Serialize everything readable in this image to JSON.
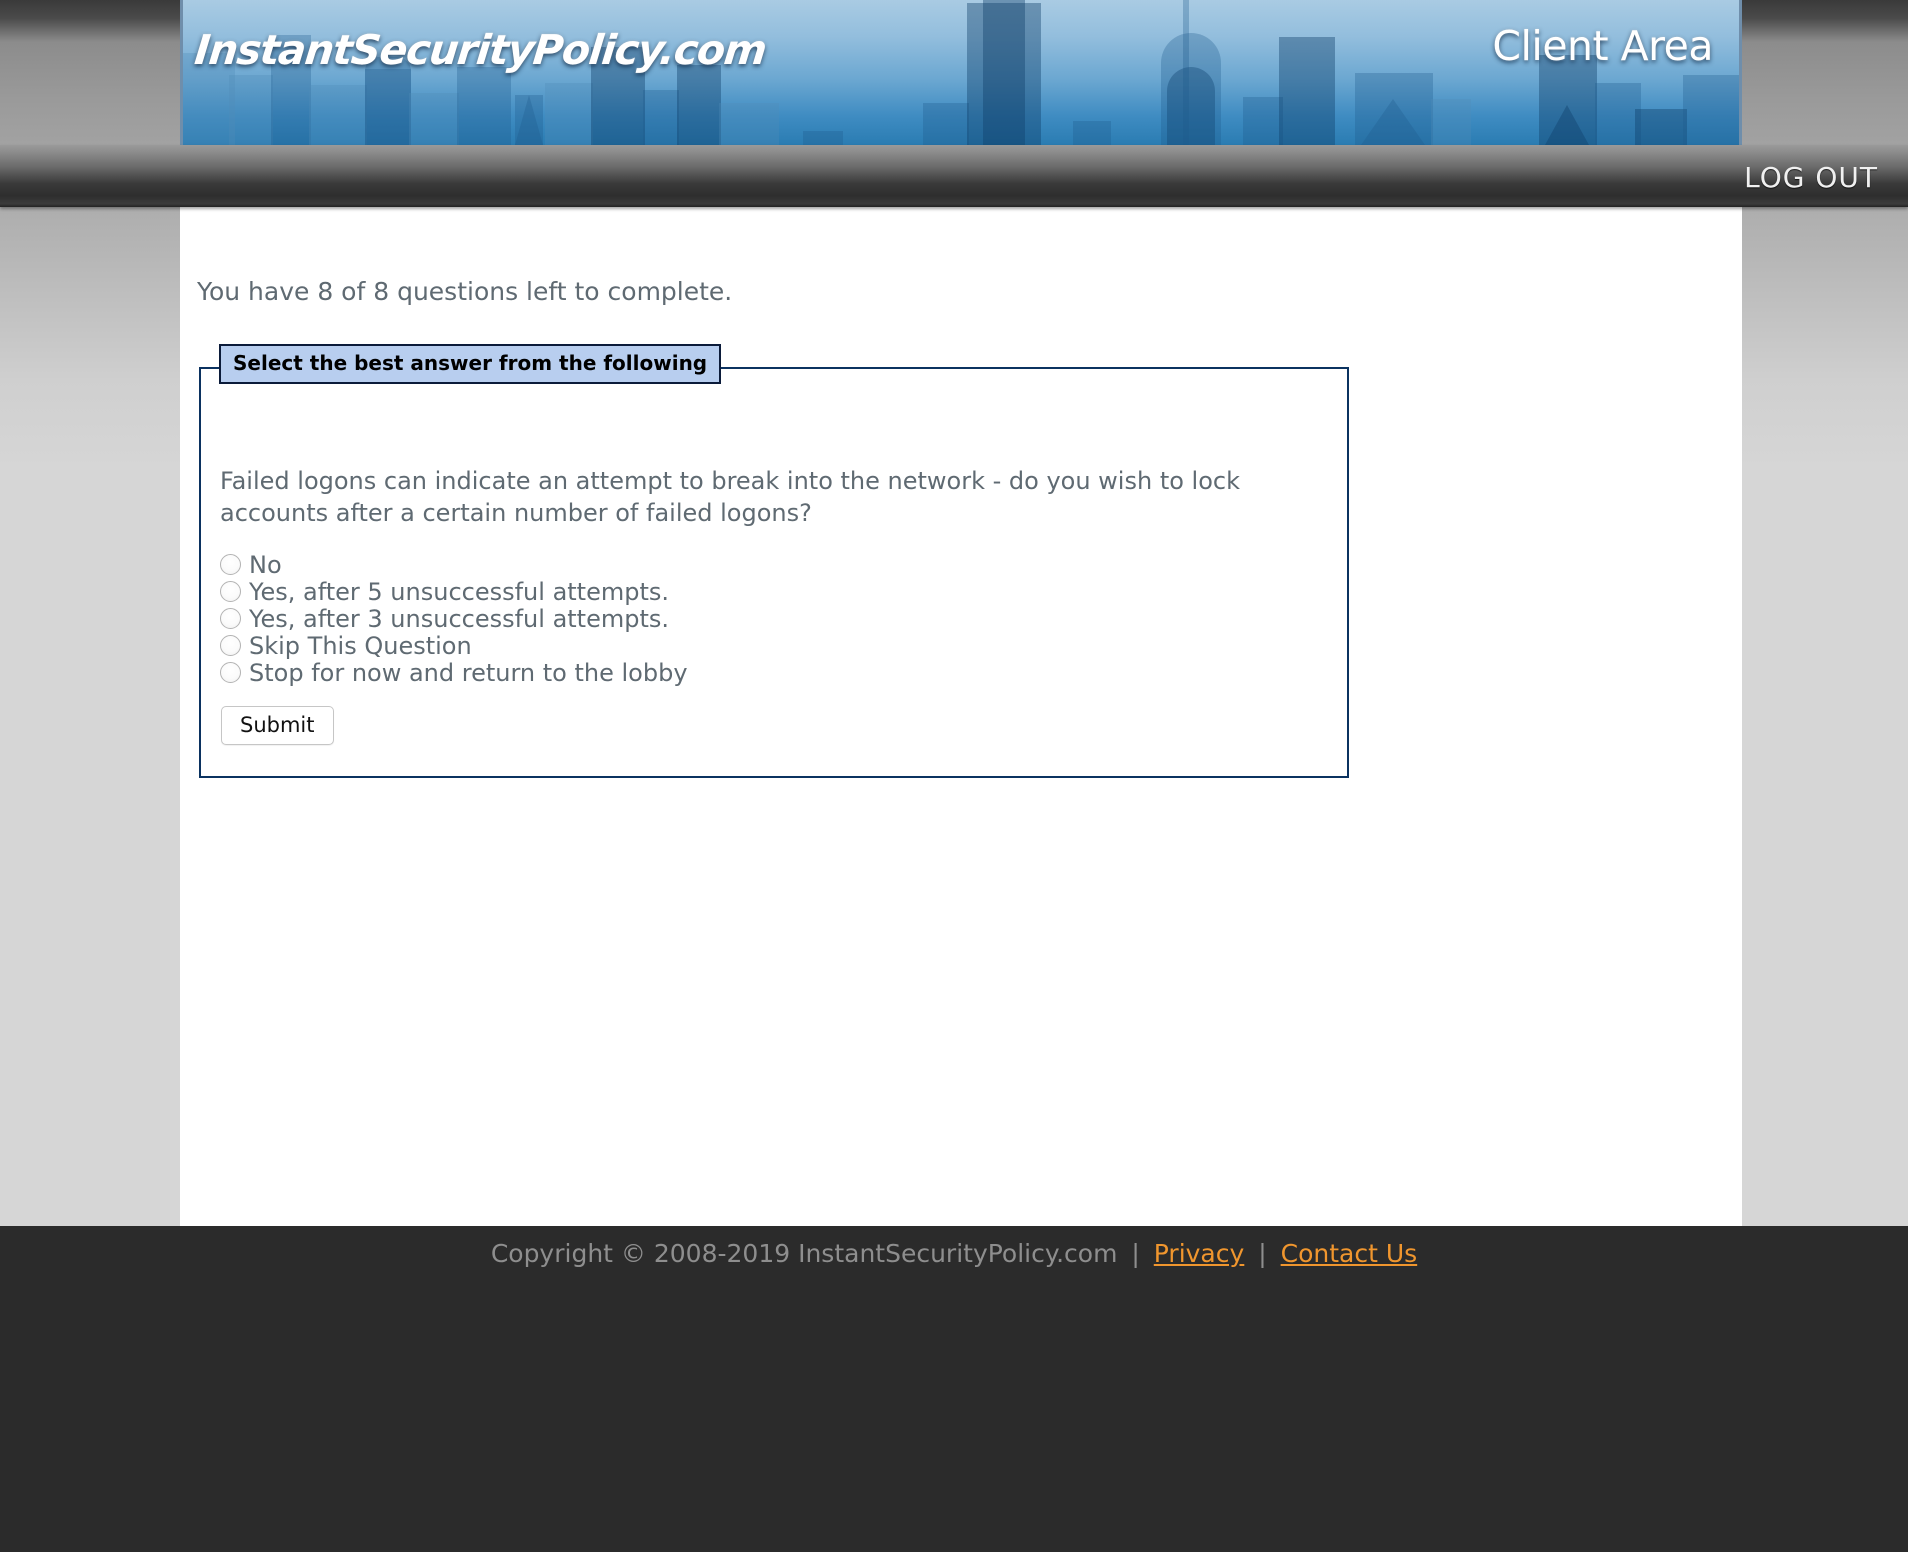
{
  "header": {
    "logo_text": "InstantSecurityPolicy.com",
    "client_area_text": "Client Area"
  },
  "nav": {
    "logout_label": "LOG OUT"
  },
  "main": {
    "questions_left": "You have 8 of 8 questions left to complete.",
    "legend": "Select the best answer from the following",
    "question": "Failed logons can indicate an attempt to break into the network - do you wish to lock accounts after a certain number of failed logons?",
    "options": [
      {
        "label": "No",
        "checked": false
      },
      {
        "label": "Yes, after 5 unsuccessful attempts.",
        "checked": false
      },
      {
        "label": "Yes, after 3 unsuccessful attempts.",
        "checked": false
      },
      {
        "label": "Skip This Question",
        "checked": false
      },
      {
        "label": "Stop for now and return to the lobby",
        "checked": false
      }
    ],
    "submit_label": "Submit"
  },
  "footer": {
    "copyright": "Copyright © 2008-2019 InstantSecurityPolicy.com",
    "separator": "|",
    "privacy_label": "Privacy",
    "contact_label": "Contact Us"
  },
  "colors": {
    "legend_bg": "#b8ceef",
    "fieldset_border": "#0b3260",
    "footer_bg": "#2b2b2b",
    "footer_link": "#f0962e",
    "body_text": "#5f6a72",
    "banner_blue": "#4f93c4"
  }
}
